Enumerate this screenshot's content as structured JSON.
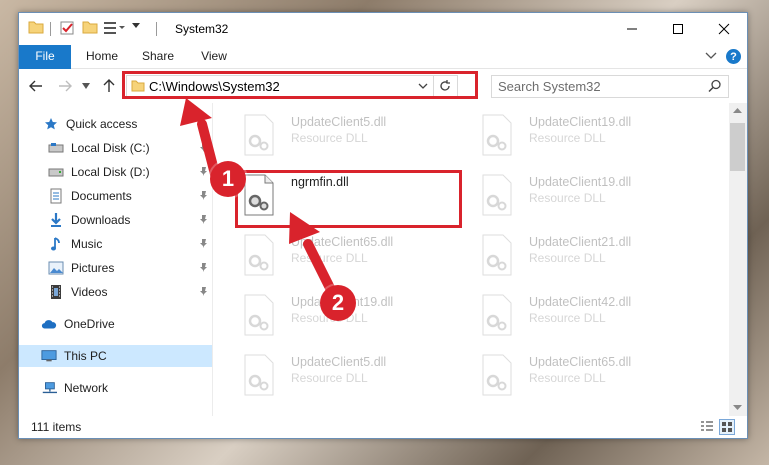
{
  "window": {
    "title": "System32"
  },
  "ribbon": {
    "tabs": [
      {
        "label": "File"
      },
      {
        "label": "Home"
      },
      {
        "label": "Share"
      },
      {
        "label": "View"
      }
    ]
  },
  "address": {
    "path": "C:\\Windows\\System32"
  },
  "search": {
    "placeholder": "Search System32"
  },
  "sidebar": {
    "items": [
      {
        "label": "Quick access",
        "icon": "star-icon"
      },
      {
        "label": "Local Disk (C:)",
        "icon": "drive-icon",
        "pinned": true
      },
      {
        "label": "Local Disk (D:)",
        "icon": "drive-icon",
        "pinned": true
      },
      {
        "label": "Documents",
        "icon": "documents-icon",
        "pinned": true
      },
      {
        "label": "Downloads",
        "icon": "download-icon",
        "pinned": true
      },
      {
        "label": "Music",
        "icon": "music-icon",
        "pinned": true
      },
      {
        "label": "Pictures",
        "icon": "pictures-icon",
        "pinned": true
      },
      {
        "label": "Videos",
        "icon": "videos-icon",
        "pinned": true
      },
      {
        "label": "OneDrive",
        "icon": "cloud-icon"
      },
      {
        "label": "This PC",
        "icon": "computer-icon",
        "selected": true
      },
      {
        "label": "Network",
        "icon": "network-icon"
      }
    ]
  },
  "files": [
    {
      "name": "UpdateClient5.dll",
      "type": "Resource DLL"
    },
    {
      "name": "UpdateClient19.dll",
      "type": "Resource DLL"
    },
    {
      "name": "ngrmfin.dll",
      "type": ""
    },
    {
      "name": "UpdateClient19.dll",
      "type": "Resource DLL"
    },
    {
      "name": "UpdateClient65.dll",
      "type": "Resource DLL"
    },
    {
      "name": "UpdateClient21.dll",
      "type": "Resource DLL"
    },
    {
      "name": "UpdateClient19.dll",
      "type": "Resource DLL"
    },
    {
      "name": "UpdateClient42.dll",
      "type": "Resource DLL"
    },
    {
      "name": "UpdateClient5.dll",
      "type": "Resource DLL"
    },
    {
      "name": "UpdateClient65.dll",
      "type": "Resource DLL"
    }
  ],
  "status": {
    "item_count": "111 items"
  },
  "annotations": [
    {
      "label": "1"
    },
    {
      "label": "2"
    }
  ],
  "colors": {
    "accent": "#1979ca",
    "annotation": "#d9232c",
    "selection": "#cce8ff"
  }
}
